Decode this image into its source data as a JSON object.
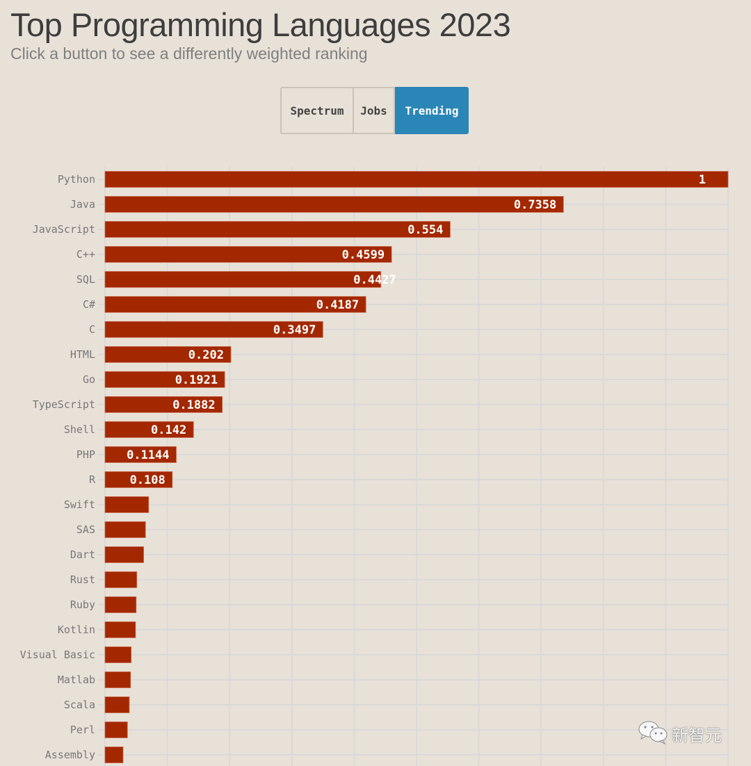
{
  "header": {
    "title": "Top Programming Languages 2023",
    "subtitle": "Click a button to see a differently weighted ranking"
  },
  "buttons": [
    {
      "label": "Spectrum",
      "active": false
    },
    {
      "label": "Jobs",
      "active": false
    },
    {
      "label": "Trending",
      "active": true
    }
  ],
  "colors": {
    "bar": "#a32800",
    "active_button": "#2a86b6",
    "background": "#e8e1d8",
    "grid": "#d9d9d9"
  },
  "watermark": {
    "icon": "wechat-icon",
    "text": "新智元"
  },
  "chart_data": {
    "type": "bar",
    "orientation": "horizontal",
    "title": "Top Programming Languages 2023",
    "subtitle": "Click a button to see a differently weighted ranking",
    "xlabel": "",
    "ylabel": "",
    "xlim": [
      0,
      1
    ],
    "grid": true,
    "grid_step": 0.1,
    "categories": [
      "Python",
      "Java",
      "JavaScript",
      "C++",
      "SQL",
      "C#",
      "C",
      "HTML",
      "Go",
      "TypeScript",
      "Shell",
      "PHP",
      "R",
      "Swift",
      "SAS",
      "Dart",
      "Rust",
      "Ruby",
      "Kotlin",
      "Visual Basic",
      "Matlab",
      "Scala",
      "Perl",
      "Assembly"
    ],
    "values": [
      1,
      0.7358,
      0.554,
      0.4599,
      0.4427,
      0.4187,
      0.3497,
      0.202,
      0.1921,
      0.1882,
      0.142,
      0.1144,
      0.108,
      0.07,
      0.065,
      0.062,
      0.051,
      0.05,
      0.049,
      0.042,
      0.041,
      0.039,
      0.036,
      0.029
    ],
    "labels": [
      "1",
      "0.7358",
      "0.554",
      "0.4599",
      "0.4427",
      "0.4187",
      "0.3497",
      "0.202",
      "0.1921",
      "0.1882",
      "0.142",
      "0.1144",
      "0.108",
      "",
      "",
      "",
      "",
      "",
      "",
      "",
      "",
      "",
      "",
      ""
    ]
  }
}
